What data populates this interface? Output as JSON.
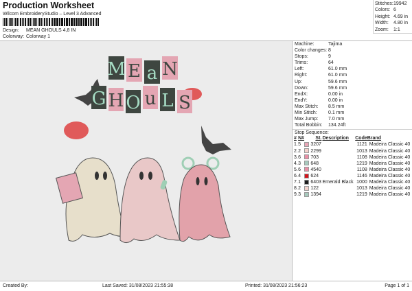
{
  "header": {
    "title": "Production Worksheet",
    "subtitle": "Wilcom EmbroideryStudio – Level 3 Advanced",
    "design_label": "Design:",
    "design_value": "MEAN GHOULS 4,8 IN",
    "colorway_label": "Colorway:",
    "colorway_value": "Colorway 1"
  },
  "summary": [
    {
      "k": "Stitches:",
      "v": "19942"
    },
    {
      "k": "Colors:",
      "v": "6"
    },
    {
      "k": "Height:",
      "v": "4.69 in"
    },
    {
      "k": "Width:",
      "v": "4.80 in"
    },
    {
      "k": "Zoom:",
      "v": "1:1"
    }
  ],
  "details": [
    {
      "k": "Machine:",
      "v": "Tajima"
    },
    {
      "k": "Color changes:",
      "v": "8"
    },
    {
      "k": "Stops:",
      "v": "9"
    },
    {
      "k": "Trims:",
      "v": "64"
    },
    {
      "k": "Left:",
      "v": "61.0 mm"
    },
    {
      "k": "Right:",
      "v": "61.0 mm"
    },
    {
      "k": "Up:",
      "v": "59.6 mm"
    },
    {
      "k": "Down:",
      "v": "59.6 mm"
    },
    {
      "k": "EndX:",
      "v": "0.00 in"
    },
    {
      "k": "EndY:",
      "v": "0.00 in"
    },
    {
      "k": "Max Stitch:",
      "v": "8.5 mm"
    },
    {
      "k": "Min Stitch:",
      "v": "0.1 mm"
    },
    {
      "k": "Max Jump:",
      "v": "7.0 mm"
    },
    {
      "k": "Total Bobbin:",
      "v": "134.24ft"
    }
  ],
  "stop_sequence": {
    "title": "Stop Sequence:",
    "headers": [
      "#",
      "N#",
      "St.",
      "Description",
      "Code",
      "Brand"
    ],
    "rows": [
      {
        "n": "1.",
        "nn": "5",
        "color": "#e8a6b6",
        "st": "3207",
        "desc": "",
        "code": "1121",
        "brand": "Madeira Classic 40"
      },
      {
        "n": "2.",
        "nn": "2",
        "color": "#f3d2cc",
        "st": "2299",
        "desc": "",
        "code": "1013",
        "brand": "Madeira Classic 40"
      },
      {
        "n": "3.",
        "nn": "6",
        "color": "#e98fa5",
        "st": "703",
        "desc": "",
        "code": "1108",
        "brand": "Madeira Classic 40"
      },
      {
        "n": "4.",
        "nn": "3",
        "color": "#a7c9bd",
        "st": "648",
        "desc": "",
        "code": "1219",
        "brand": "Madeira Classic 40"
      },
      {
        "n": "5.",
        "nn": "6",
        "color": "#e98fa5",
        "st": "4540",
        "desc": "",
        "code": "1108",
        "brand": "Madeira Classic 40"
      },
      {
        "n": "6.",
        "nn": "4",
        "color": "#d4141c",
        "st": "624",
        "desc": "",
        "code": "1146",
        "brand": "Madeira Classic 40"
      },
      {
        "n": "7.",
        "nn": "1",
        "color": "#1e1e1e",
        "st": "6403",
        "desc": "Emerald Black",
        "code": "1000",
        "brand": "Madeira Classic 40"
      },
      {
        "n": "8.",
        "nn": "2",
        "color": "#f3d2cc",
        "st": "122",
        "desc": "",
        "code": "1013",
        "brand": "Madeira Classic 40"
      },
      {
        "n": "9.",
        "nn": "3",
        "color": "#a7c9bd",
        "st": "1394",
        "desc": "",
        "code": "1219",
        "brand": "Madeira Classic 40"
      }
    ]
  },
  "artwork_lettering": {
    "line1": [
      "M",
      "E",
      "a",
      "N"
    ],
    "line2": [
      "G",
      "H",
      "O",
      "u",
      "L",
      "S"
    ]
  },
  "footer": {
    "created": "Created By:",
    "saved": "Last Saved: 31/08/2023 21:55:38",
    "printed": "Printed: 31/08/2023 21:56:23",
    "page": "Page 1 of 1"
  }
}
